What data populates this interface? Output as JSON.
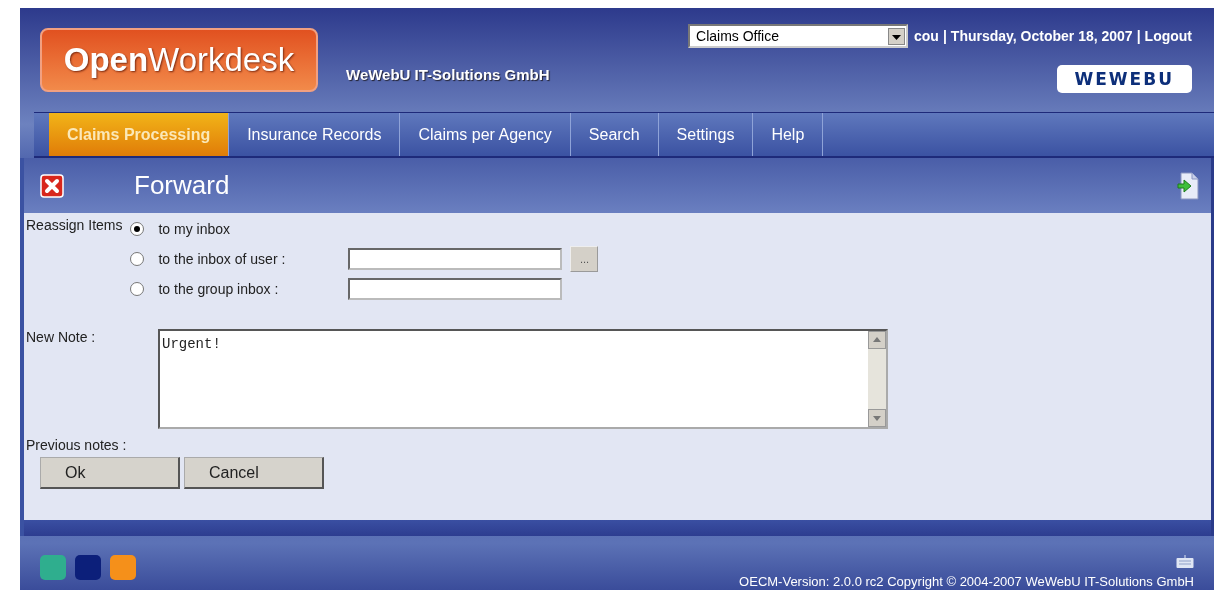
{
  "header": {
    "logo": "**Open**Workdesk",
    "company": "WeWebU IT-Solutions GmbH",
    "office_select": {
      "value": "Claims Office"
    },
    "user": "cou",
    "separator": "|",
    "date": "Thursday, October 18, 2007",
    "logout": "Logout",
    "brand_logo": "WEWEBU"
  },
  "tabs": [
    {
      "label": "Claims Processing",
      "selected": true
    },
    {
      "label": "Insurance Records",
      "selected": false
    },
    {
      "label": "Claims per Agency",
      "selected": false
    },
    {
      "label": "Search",
      "selected": false
    },
    {
      "label": "Settings",
      "selected": false
    },
    {
      "label": "Help",
      "selected": false
    }
  ],
  "dialog": {
    "title": "Forward",
    "reassign_label": "Reassign Items",
    "options": [
      {
        "label": "to my inbox",
        "selected": true,
        "kind": "plain"
      },
      {
        "label": "to the inbox of user :",
        "selected": false,
        "kind": "user"
      },
      {
        "label": "to the group inbox :",
        "selected": false,
        "kind": "group"
      }
    ],
    "browse_button": "...",
    "note_label": "New Note :",
    "note_value": "Urgent!",
    "previous_notes_label": "Previous notes :",
    "buttons": [
      "Ok",
      "Cancel"
    ]
  },
  "footer": {
    "themes": [
      {
        "color": "#2fae8e"
      },
      {
        "color": "#0c1f7a"
      },
      {
        "color": "#f5901a"
      }
    ],
    "version": "OECM-Version: 2.0.0 rc2 Copyright © 2004-2007 WeWebU IT-Solutions GmbH"
  }
}
